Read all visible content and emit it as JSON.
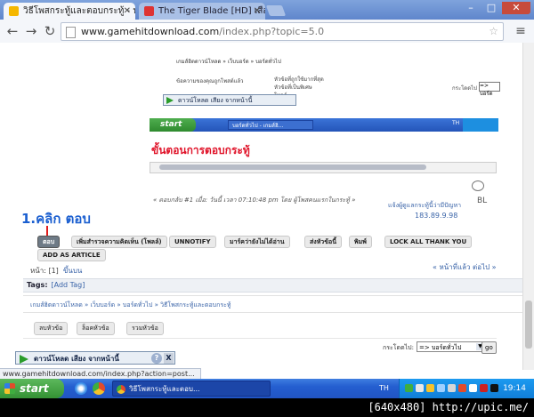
{
  "browser": {
    "tabs": [
      {
        "label": "วิธีโพสกระทู้และตอบกระทู้ - บ"
      },
      {
        "label": "The Tiger Blade [HD] เสือคาบ"
      }
    ],
    "win_minimize": "–",
    "win_maximize": "□",
    "win_close": "✕",
    "back_icon": "←",
    "forward_icon": "→",
    "reload_icon": "↻",
    "url_host": "www.gamehitdownload.com",
    "url_path": "/index.php?topic=5.0",
    "star_icon": "☆",
    "menu_icon": "≡",
    "status_url": "www.gamehitdownload.com/index.php?action=post..."
  },
  "embedded": {
    "breadcrumb": "เกมส์ฮิตดาวน์โหลด » เว็บบอร์ด » บอร์ดทั่วไป",
    "row1": "ข้อความของคุณถูกโพสต์แล้ว",
    "row2a": "หัวข้อที่ถูกใช้มากที่สุด",
    "row2b": "หัวข้อที่เป็นพิเศษ",
    "row2c": "โพลล์",
    "jump_label": "กระโดดไป",
    "jump_value": "=> บอร์ด",
    "dl_label": "ดาวน์โหลด เสียง จากหน้านี้",
    "start": "start",
    "task": "บอร์ดทั่วไป - เกมส์ฮิ...",
    "tray_lang": "TH",
    "heading": "ขั้นตอนการตอบกระทู้"
  },
  "post": {
    "quote": "« ตอบกลับ #1 เมื่อ: วันนี้ เวลา 07:10:48 pm โดย ผู้โพสคนแรกในกระทู้ »",
    "report": "แจ้งผู้ดูแลกระทู้นี้ว่ามีปัญหา",
    "ip": "183.89.9.98",
    "bl_icon": "BL"
  },
  "annotation": {
    "text": "1.คลิก ตอบ"
  },
  "buttons": [
    {
      "label": "ตอบ"
    },
    {
      "label": "เพิ่มสำรวจความคิดเห็น (โพลล์)"
    },
    {
      "label": "UNNOTIFY"
    },
    {
      "label": "มาร์คว่ายังไม่ได้อ่าน"
    },
    {
      "label": "ส่งหัวข้อนี้"
    },
    {
      "label": "พิมพ์"
    },
    {
      "label": "LOCK ALL THANK YOU"
    },
    {
      "label": "ADD AS ARTICLE"
    }
  ],
  "pagination": {
    "pages_prefix": "หน้า: [1]",
    "go_up": "ขึ้นบน",
    "prev_next": "« หน้าที่แล้ว ต่อไป »"
  },
  "tags": {
    "label": "Tags:",
    "add": "[Add Tag]"
  },
  "breadcrumb2": "เกมส์ฮิตดาวน์โหลด » เว็บบอร์ด » บอร์ดทั่วไป » วิธีโพสกระทู้และตอบกระทู้",
  "link_buttons": [
    {
      "label": "ลบหัวข้อ"
    },
    {
      "label": "ล็อคหัวข้อ"
    },
    {
      "label": "รวมหัวข้อ"
    }
  ],
  "jump": {
    "label": "กระโดดไป:",
    "value": "=> บอร์ดทั่วไป",
    "go": "go"
  },
  "download_toolbar": {
    "label": "ดาวน์โหลด เสียง จากหน้านี้",
    "help": "?",
    "close": "X"
  },
  "taskbar": {
    "start": "start",
    "task": "วิธีโพสกระทู้และตอบ...",
    "lang": "TH",
    "clock": "19:14"
  },
  "watermark": "[640x480] http://upic.me/"
}
